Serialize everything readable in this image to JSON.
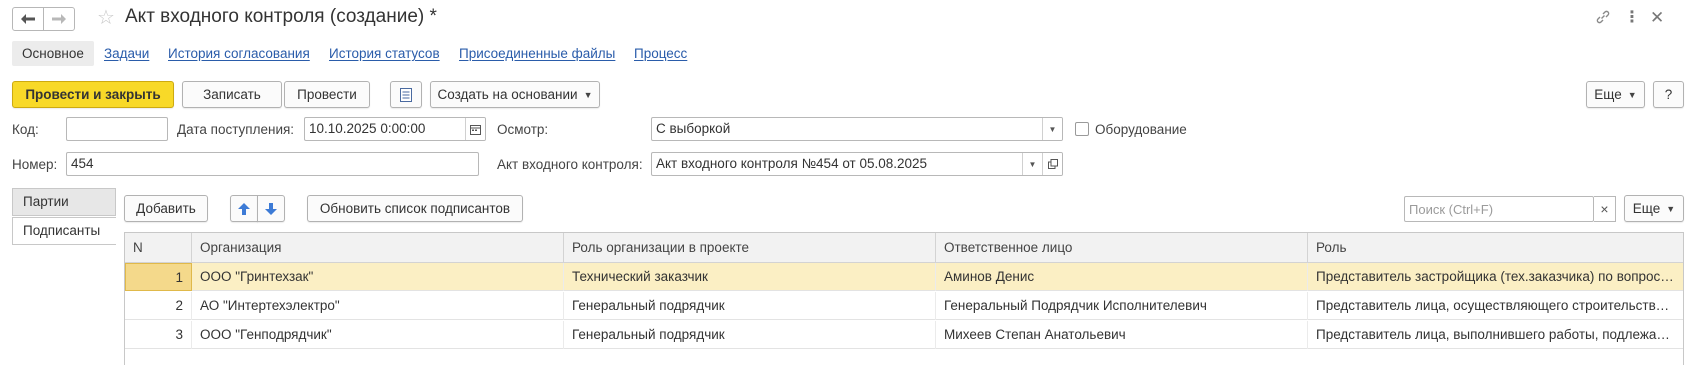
{
  "window": {
    "title": "Акт входного контроля (создание) *"
  },
  "nav_tabs": [
    {
      "label": "Основное"
    },
    {
      "label": "Задачи"
    },
    {
      "label": "История согласования"
    },
    {
      "label": "История статусов"
    },
    {
      "label": "Присоединенные файлы"
    },
    {
      "label": "Процесс"
    }
  ],
  "toolbar": {
    "post_close": "Провести и закрыть",
    "save": "Записать",
    "post": "Провести",
    "create_based": "Создать на основании",
    "more": "Еще",
    "help": "?"
  },
  "form": {
    "code_label": "Код:",
    "code_value": "",
    "date_label": "Дата поступления:",
    "date_value": "10.10.2025  0:00:00",
    "inspection_label": "Осмотр:",
    "inspection_value": "С выборкой",
    "equipment_label": "Оборудование",
    "number_label": "Номер:",
    "number_value": "454",
    "act_label": "Акт входного контроля:",
    "act_value": "Акт входного контроля №454 от 05.08.2025"
  },
  "side_tabs": [
    {
      "label": "Партии"
    },
    {
      "label": "Подписанты"
    }
  ],
  "table_toolbar": {
    "add": "Добавить",
    "refresh": "Обновить список подписантов",
    "search_placeholder": "Поиск (Ctrl+F)",
    "clear": "×",
    "more": "Еще"
  },
  "table": {
    "columns": [
      "N",
      "Организация",
      "Роль организации в проекте",
      "Ответственное лицо",
      "Роль"
    ],
    "rows": [
      {
        "n": "1",
        "org": "ООО \"Гринтехзак\"",
        "org_role": "Технический заказчик",
        "person": "Аминов Денис",
        "role": "Представитель застройщика (тех.заказчика) по вопросам строительного контроля"
      },
      {
        "n": "2",
        "org": "АО \"Интертехэлектро\"",
        "org_role": "Генеральный подрядчик",
        "person": "Генеральный Подрядчик Исполнителевич",
        "role": "Представитель лица, осуществляющего строительство, по вопросам"
      },
      {
        "n": "3",
        "org": "ООО \"Генподрядчик\"",
        "org_role": "Генеральный подрядчик",
        "person": "Михеев Степан Анатольевич",
        "role": "Представитель лица, выполнившего работы, подлежащие освидетельствованию"
      }
    ]
  },
  "colors": {
    "primary_button": "#f8d928",
    "link": "#2a5caa",
    "selected_row": "#fbefc4"
  }
}
